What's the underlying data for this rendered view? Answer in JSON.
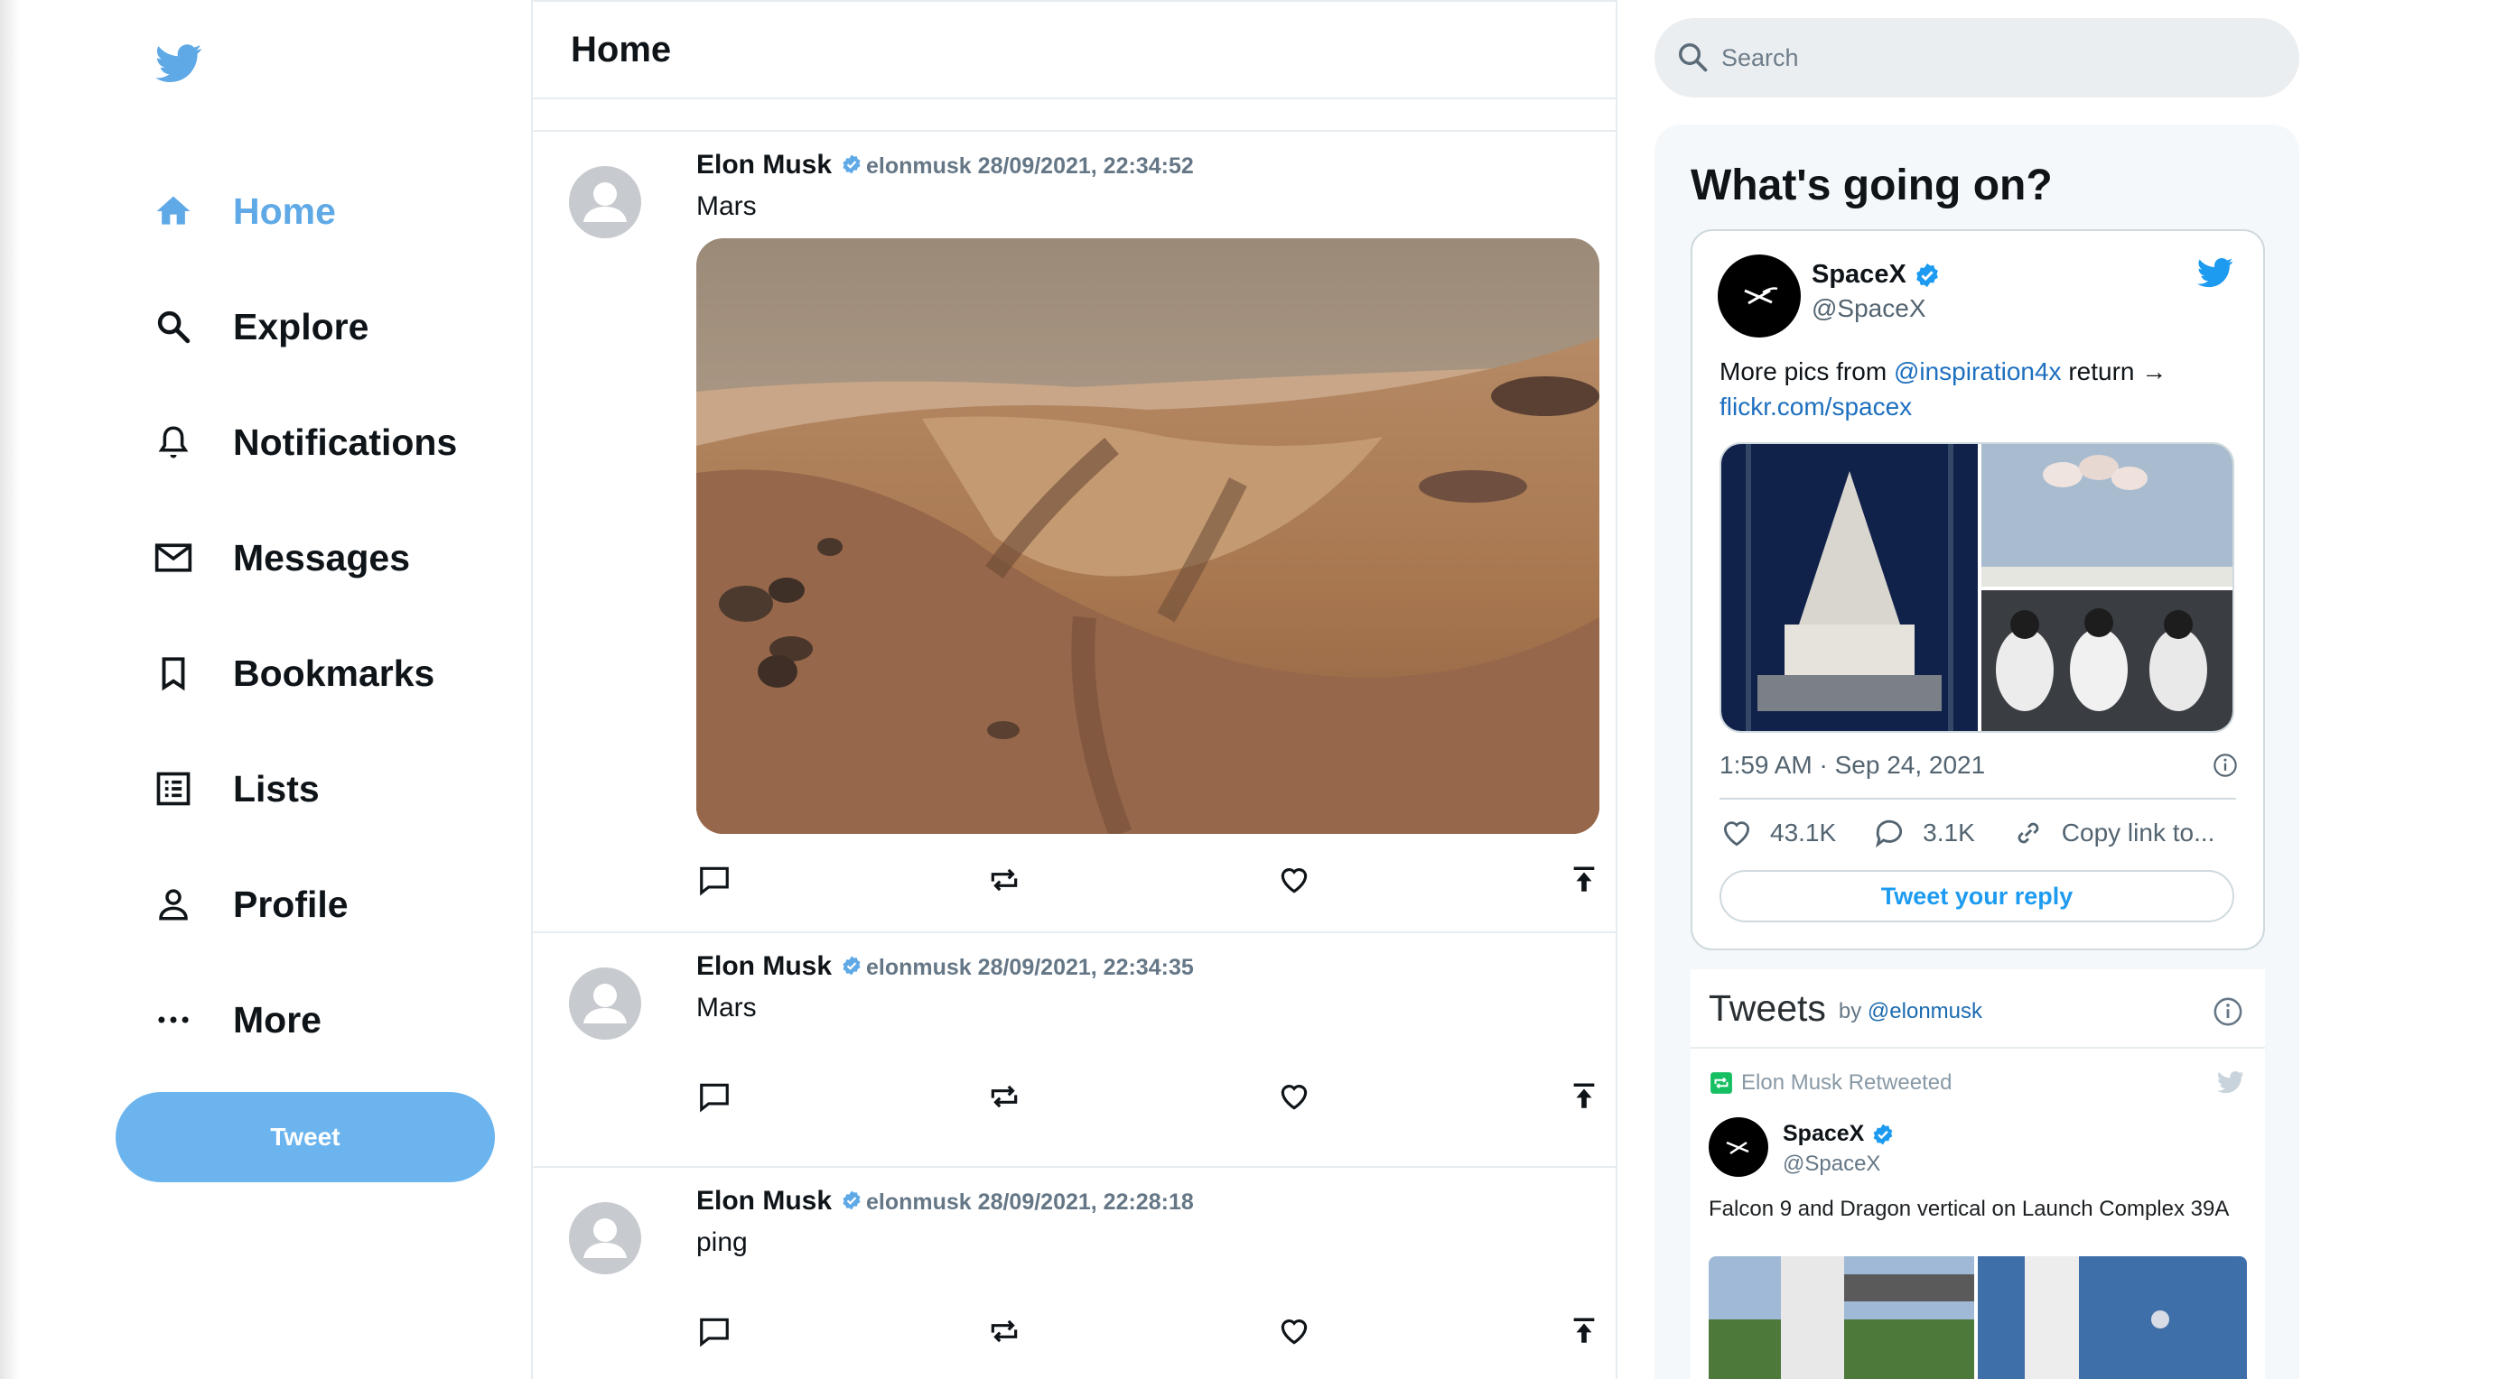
{
  "nav": {
    "items": [
      {
        "label": "Home",
        "icon": "home-icon",
        "active": true
      },
      {
        "label": "Explore",
        "icon": "search-icon"
      },
      {
        "label": "Notifications",
        "icon": "bell-icon"
      },
      {
        "label": "Messages",
        "icon": "mail-icon"
      },
      {
        "label": "Bookmarks",
        "icon": "bookmark-icon"
      },
      {
        "label": "Lists",
        "icon": "list-icon"
      },
      {
        "label": "Profile",
        "icon": "person-icon"
      },
      {
        "label": "More",
        "icon": "more-icon"
      }
    ],
    "tweet_button": "Tweet"
  },
  "colors": {
    "accent": "#5fa9e6",
    "tweet_button": "#6cb4ee",
    "link": "#1d9bf0"
  },
  "feed": {
    "title": "Home",
    "posts": [
      {
        "name": "Elon Musk",
        "meta": "elonmusk 28/09/2021, 22:34:52",
        "text": "Mars",
        "has_image": true
      },
      {
        "name": "Elon Musk",
        "meta": "elonmusk 28/09/2021, 22:34:35",
        "text": "Mars",
        "has_image": false
      },
      {
        "name": "Elon Musk",
        "meta": "elonmusk 28/09/2021, 22:28:18",
        "text": "ping",
        "has_image": false
      }
    ]
  },
  "search": {
    "placeholder": "Search"
  },
  "trends": {
    "title": "What's going on?",
    "embed": {
      "name": "SpaceX",
      "handle": "@SpaceX",
      "text_before": "More pics from ",
      "mention": "@inspiration4x",
      "text_after": " return →",
      "link": "flickr.com/spacex",
      "time": "1:59 AM · Sep 24, 2021",
      "likes": "43.1K",
      "replies": "3.1K",
      "copy_link": "Copy link to...",
      "reply_button": "Tweet your reply"
    },
    "timeline": {
      "title": "Tweets",
      "by": "by",
      "by_handle": "@elonmusk",
      "retweeted": "Elon Musk Retweeted",
      "name": "SpaceX",
      "handle": "@SpaceX",
      "text": "Falcon 9 and Dragon vertical on Launch Complex 39A"
    }
  }
}
